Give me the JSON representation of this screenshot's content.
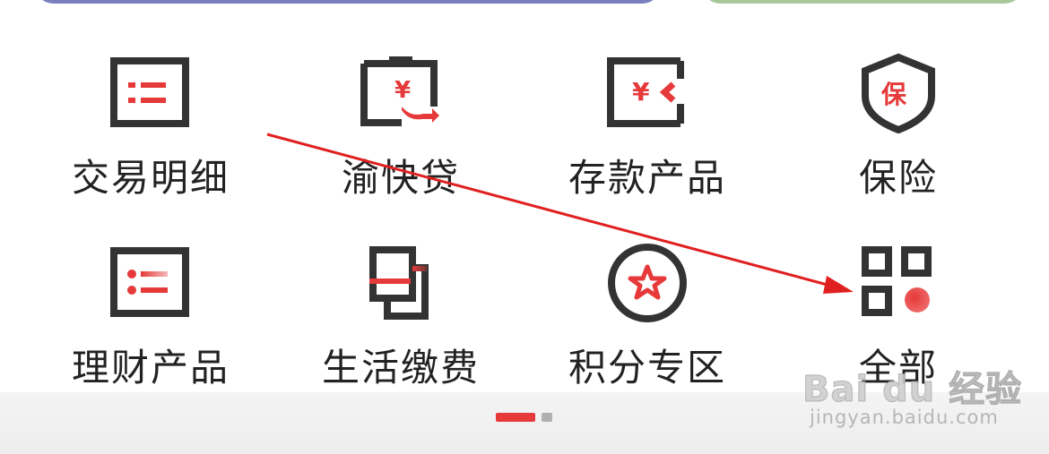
{
  "menu": {
    "row1": [
      {
        "label": "交易明细",
        "icon": "transaction-list-icon"
      },
      {
        "label": "渝快贷",
        "icon": "loan-yen-icon"
      },
      {
        "label": "存款产品",
        "icon": "deposit-yen-icon"
      },
      {
        "label": "保险",
        "icon": "insurance-shield-icon"
      }
    ],
    "row2": [
      {
        "label": "理财产品",
        "icon": "wealth-list-icon"
      },
      {
        "label": "生活缴费",
        "icon": "bill-payment-icon"
      },
      {
        "label": "积分专区",
        "icon": "points-star-icon"
      },
      {
        "label": "全部",
        "icon": "all-grid-icon"
      }
    ]
  },
  "icon_text": {
    "yen": "¥",
    "insurance": "保"
  },
  "watermark": {
    "brand": "Bai du 经验",
    "url": "jingyan.baidu.com"
  },
  "colors": {
    "accent": "#e5393a",
    "icon_dark": "#333333",
    "label": "#222222"
  }
}
